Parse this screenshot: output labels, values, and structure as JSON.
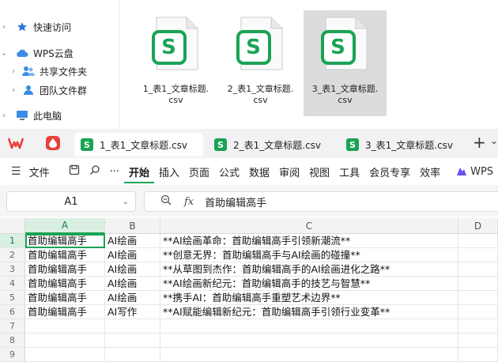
{
  "explorer": {
    "nav": [
      {
        "label": "快速访问",
        "icon": "star-icon"
      },
      {
        "label": "WPS云盘",
        "icon": "cloud-icon"
      },
      {
        "label": "共享文件夹",
        "icon": "shared-folder-icon"
      },
      {
        "label": "团队文件群",
        "icon": "team-icon"
      },
      {
        "label": "此电脑",
        "icon": "computer-icon"
      }
    ],
    "files": [
      {
        "name_line1": "1_表1_文章标题.",
        "name_line2": "csv",
        "badge": "S"
      },
      {
        "name_line1": "2_表1_文章标题.",
        "name_line2": "csv",
        "badge": "S"
      },
      {
        "name_line1": "3_表1_文章标题.",
        "name_line2": "csv",
        "badge": "S"
      }
    ]
  },
  "tabs": {
    "items": [
      {
        "label": "1_表1_文章标题.csv",
        "badge": "S",
        "close": "×"
      },
      {
        "label": "2_表1_文章标题.csv",
        "badge": "S",
        "close": "×"
      },
      {
        "label": "3_表1_文章标题.csv",
        "badge": "S",
        "close": "×"
      }
    ],
    "new_tab": "+",
    "more": "⌄"
  },
  "menu": {
    "file": "文件",
    "more": "···",
    "items": [
      "开始",
      "插入",
      "页面",
      "公式",
      "数据",
      "审阅",
      "视图",
      "工具",
      "会员专享",
      "效率"
    ],
    "wps_ai": "WPS"
  },
  "formula": {
    "cell_ref": "A1",
    "fx": "fx",
    "value": "首助编辑高手"
  },
  "sheet": {
    "columns": [
      "A",
      "B",
      "C",
      "D"
    ],
    "row_numbers": [
      "1",
      "2",
      "3",
      "4",
      "5",
      "6",
      "7",
      "8",
      "9"
    ],
    "rows": [
      [
        "首助编辑高手",
        "AI绘画",
        "**AI绘画革命：首助编辑高手引领新潮流**"
      ],
      [
        "首助编辑高手",
        "AI绘画",
        "**创意无界：首助编辑高手与AI绘画的碰撞**"
      ],
      [
        "首助编辑高手",
        "AI绘画",
        "**从草图到杰作：首助编辑高手的AI绘画进化之路**"
      ],
      [
        "首助编辑高手",
        "AI绘画",
        "**AI绘画新纪元：首助编辑高手的技艺与智慧**"
      ],
      [
        "首助编辑高手",
        "AI绘画",
        "**携手AI：首助编辑高手重塑艺术边界**"
      ],
      [
        "首助编辑高手",
        "AI写作",
        "**AI赋能编辑新纪元：首助编辑高手引领行业变革**"
      ]
    ]
  },
  "colors": {
    "accent": "#1aa355",
    "wps_red": "#e8403a"
  }
}
